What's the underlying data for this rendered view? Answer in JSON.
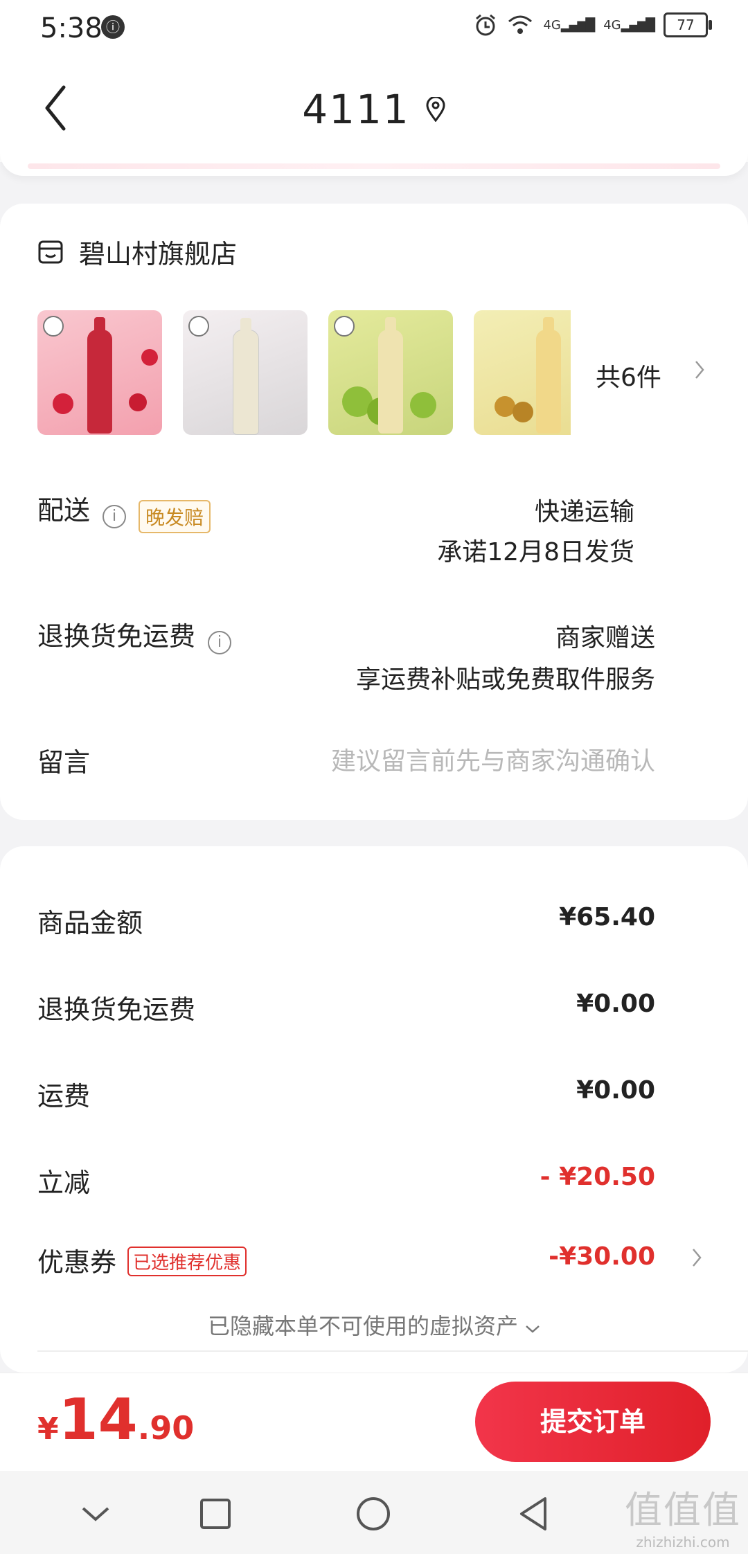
{
  "status_bar": {
    "time": "5:38",
    "badge": "ⓘ",
    "network_a": "4G",
    "network_b": "4G",
    "battery": "77"
  },
  "header": {
    "title": "4111"
  },
  "store": {
    "name": "碧山村旗舰店",
    "product_count": "共6件",
    "delivery": {
      "label": "配送",
      "tag": "晚发赔",
      "method": "快递运输",
      "promise": "承诺12月8日发货"
    },
    "returns": {
      "label": "退换货免运费",
      "value": "商家赠送",
      "desc": "享运费补贴或免费取件服务"
    },
    "message": {
      "label": "留言",
      "placeholder": "建议留言前先与商家沟通确认"
    }
  },
  "pricing": {
    "rows": [
      {
        "label": "商品金额",
        "amount": "¥65.40"
      },
      {
        "label": "退换货免运费",
        "amount": "¥0.00"
      },
      {
        "label": "运费",
        "amount": "¥0.00"
      },
      {
        "label": "立减",
        "amount": "- ¥20.50"
      },
      {
        "label": "优惠券",
        "tag": "已选推荐优惠",
        "amount": "-¥30.00"
      }
    ],
    "hidden_assets": "已隐藏本单不可使用的虚拟资产"
  },
  "bottom": {
    "currency": "¥",
    "total_int": "14",
    "total_dec": ".90",
    "submit_label": "提交订单"
  },
  "watermark": {
    "big": "值值值",
    "small": "zhizhizhi.com"
  },
  "colors": {
    "accent_red": "#e0302d",
    "tag_orange": "#c88a22"
  }
}
